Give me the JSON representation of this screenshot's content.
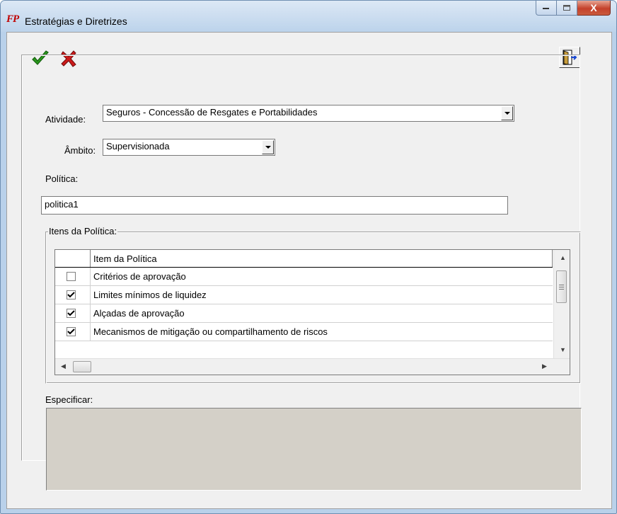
{
  "window": {
    "title": "Estratégias e Diretrizes",
    "logo_text": "FP",
    "minimize_icon": "minimize-icon",
    "maximize_icon": "maximize-icon",
    "close_label": "X"
  },
  "toolbar": {
    "confirm_icon": "green-check-icon",
    "cancel_icon": "red-x-icon",
    "exit_icon": "exit-door-icon"
  },
  "form": {
    "atividade_label": "Atividade:",
    "atividade_value": "Seguros - Concessão de Resgates e Portabilidades",
    "ambito_label": "Âmbito:",
    "ambito_value": "Supervisionada",
    "politica_label": "Política:",
    "politica_value": "politica1",
    "itens_group_title": "Itens da Política:",
    "especificar_label": "Especificar:"
  },
  "grid": {
    "header": "Item da Política",
    "rows": [
      {
        "label": "Critérios de aprovação",
        "checked": false
      },
      {
        "label": "Limites mínimos de liquidez",
        "checked": true
      },
      {
        "label": "Alçadas de aprovação",
        "checked": true
      },
      {
        "label": "Mecanismos de mitigação ou compartilhamento de riscos",
        "checked": true
      }
    ]
  },
  "colors": {
    "title_bar": "#bcd3eb",
    "client_bg": "#f0f0f0",
    "specify_bg": "#d4d0c8",
    "close_button": "#c4412b"
  }
}
